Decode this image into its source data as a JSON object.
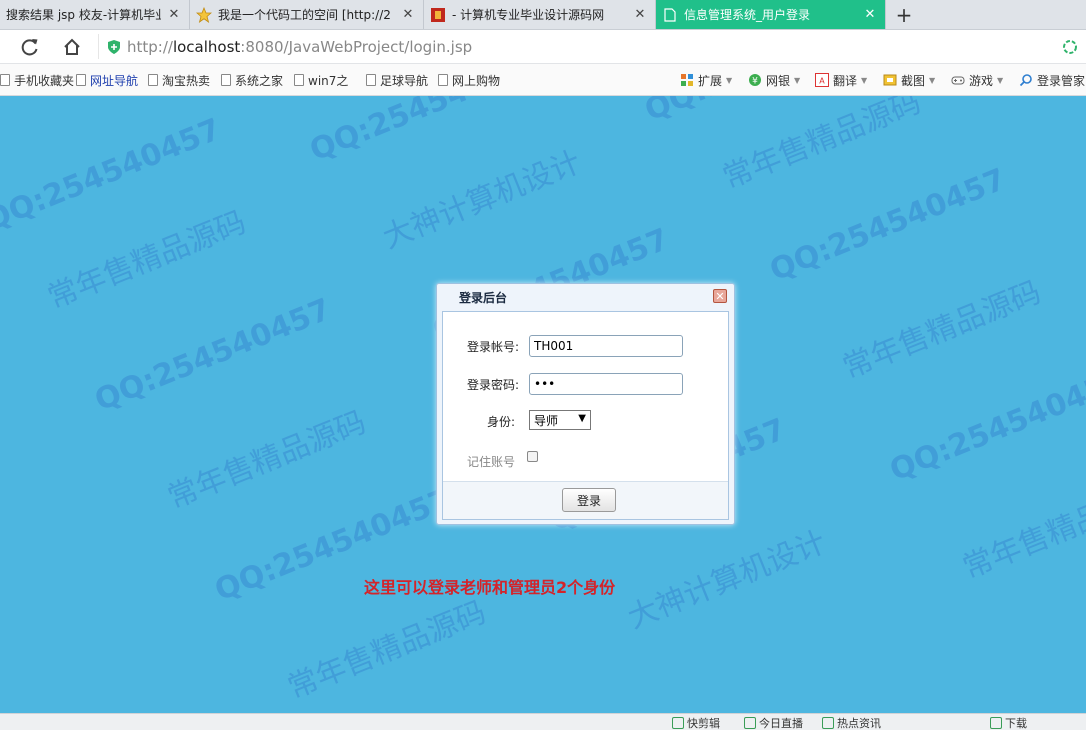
{
  "browser": {
    "tabs": [
      {
        "title": "搜索结果 jsp 校友-计算机毕业设",
        "active": false,
        "icon": "search-icon"
      },
      {
        "title": "我是一个代码工的空间 [http://2",
        "active": false,
        "icon": "star-icon"
      },
      {
        "title": "- 计算机专业毕业设计源码网",
        "active": false,
        "icon": "site-favicon-icon"
      },
      {
        "title": "信息管理系统_用户登录",
        "active": true,
        "icon": "page-icon"
      }
    ],
    "close_glyph": "✕",
    "new_tab_glyph": "+",
    "url_scheme": "http://",
    "url_host": "localhost",
    "url_rest": ":8080/JavaWebProject/login.jsp",
    "active_tab_color": "#20c08a"
  },
  "bookmarks": [
    {
      "label": "手机收藏夹",
      "highlight": false
    },
    {
      "label": "网址导航",
      "highlight": true
    },
    {
      "label": "淘宝热卖",
      "highlight": false
    },
    {
      "label": "系统之家",
      "highlight": false
    },
    {
      "label": "win7之",
      "highlight": false
    },
    {
      "label": "足球导航",
      "highlight": false
    },
    {
      "label": "网上购物",
      "highlight": false
    }
  ],
  "toolbar": {
    "extensions": "扩展",
    "bank": "网银",
    "translate": "翻译",
    "screenshot": "截图",
    "games": "游戏",
    "login_manager": "登录管家"
  },
  "login": {
    "title": "登录后台",
    "account_label": "登录帐号:",
    "account_value": "TH001",
    "password_label": "登录密码:",
    "password_value": "•••",
    "role_label": "身份:",
    "role_selected": "导师",
    "role_arrow": "▼",
    "remember_label": "记住账号",
    "remember_checked": false,
    "submit_label": "登录"
  },
  "notice": "这里可以登录老师和管理员2个身份",
  "watermarks": {
    "qq": "QQ:254540457",
    "design": "大神计算机设计",
    "sale": "常年售精品源码"
  },
  "statusbar": [
    {
      "label": "快剪辑"
    },
    {
      "label": "今日直播"
    },
    {
      "label": "热点资讯"
    },
    {
      "label": "下载"
    }
  ],
  "colors": {
    "page_background": "#4db6e0",
    "notice_text": "#d4242a"
  }
}
